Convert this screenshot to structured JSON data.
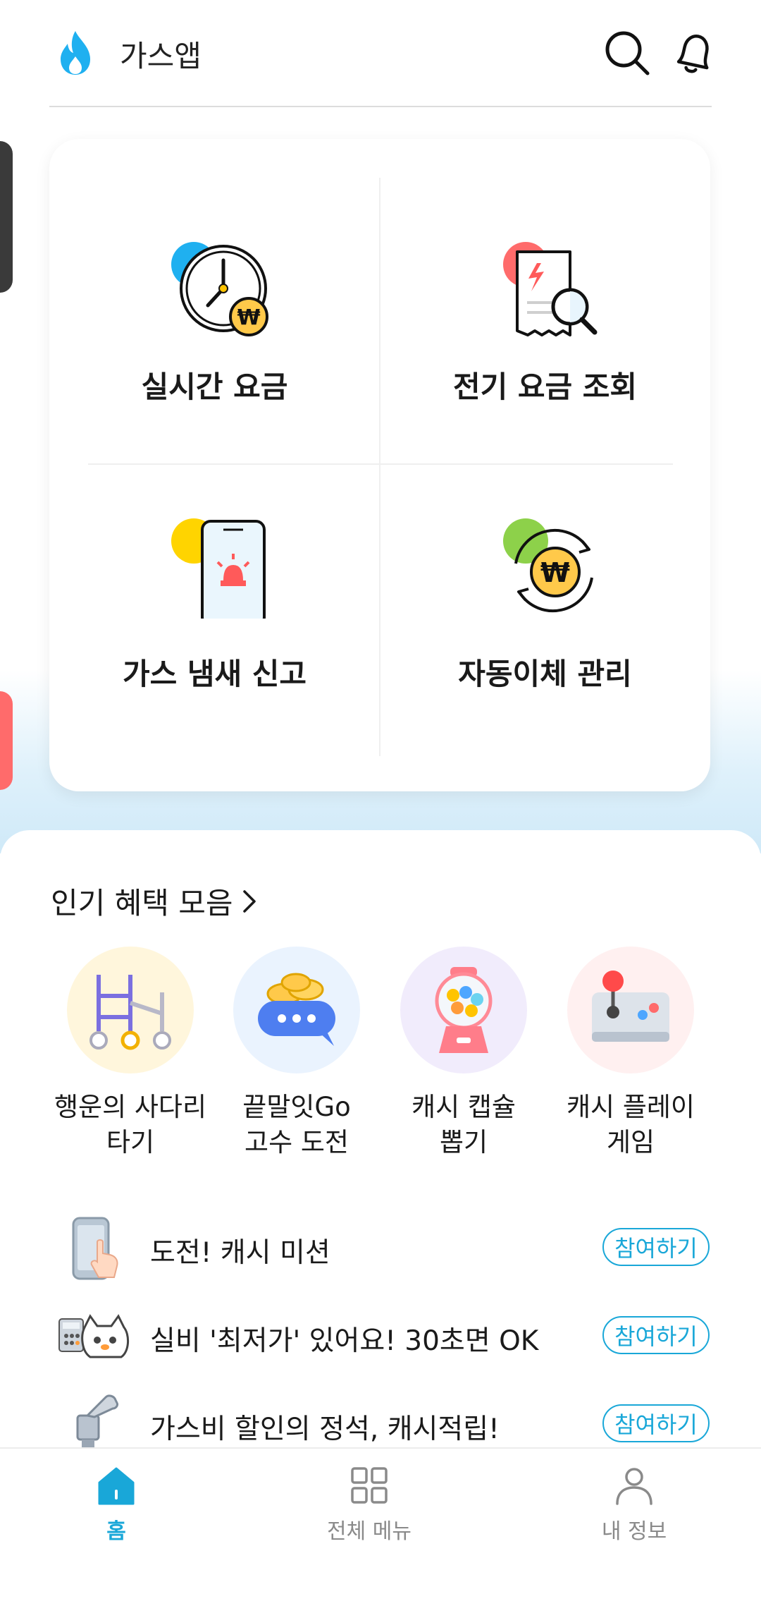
{
  "header": {
    "app_title": "가스앱",
    "icons": {
      "logo": "flame-icon",
      "search": "search-icon",
      "notifications": "bell-icon"
    }
  },
  "services": [
    {
      "label": "실시간 요금",
      "icon": "clock-won-icon",
      "accent": "#1fb0f0"
    },
    {
      "label": "전기 요금 조회",
      "icon": "bill-search-icon",
      "accent": "#ff6b6b"
    },
    {
      "label": "가스 냄새 신고",
      "icon": "phone-siren-icon",
      "accent": "#ffd400"
    },
    {
      "label": "자동이체 관리",
      "icon": "auto-transfer-icon",
      "accent": "#8dd14a"
    }
  ],
  "benefits": {
    "title": "인기 혜택 모음",
    "items": [
      {
        "line1": "행운의 사다리",
        "line2": "타기",
        "icon": "ladder-icon",
        "bg": "#fff6dc"
      },
      {
        "line1": "끝말잇Go",
        "line2": "고수 도전",
        "icon": "chat-coins-icon",
        "bg": "#eaf3fe"
      },
      {
        "line1": "캐시 캡슐",
        "line2": "뽑기",
        "icon": "gumball-machine-icon",
        "bg": "#f1ecfc"
      },
      {
        "line1": "캐시 플레이",
        "line2": "게임",
        "icon": "arcade-controller-icon",
        "bg": "#fff0f0"
      }
    ]
  },
  "missions": [
    {
      "text": "도전! 캐시 미션",
      "button": "참여하기",
      "icon": "phone-tap-icon"
    },
    {
      "text": "실비 '최저가' 있어요! 30초면 OK",
      "button": "참여하기",
      "icon": "calculator-cat-icon"
    },
    {
      "text": "가스비 할인의 정석, 캐시적립!",
      "button": "참여하기",
      "icon": "gas-valve-icon"
    }
  ],
  "bottom_nav": [
    {
      "label": "홈",
      "icon": "home-icon",
      "active": true
    },
    {
      "label": "전체 메뉴",
      "icon": "grid-icon",
      "active": false
    },
    {
      "label": "내 정보",
      "icon": "person-icon",
      "active": false
    }
  ],
  "colors": {
    "accent": "#19a7d8",
    "nav_inactive": "#8a8a8a"
  }
}
